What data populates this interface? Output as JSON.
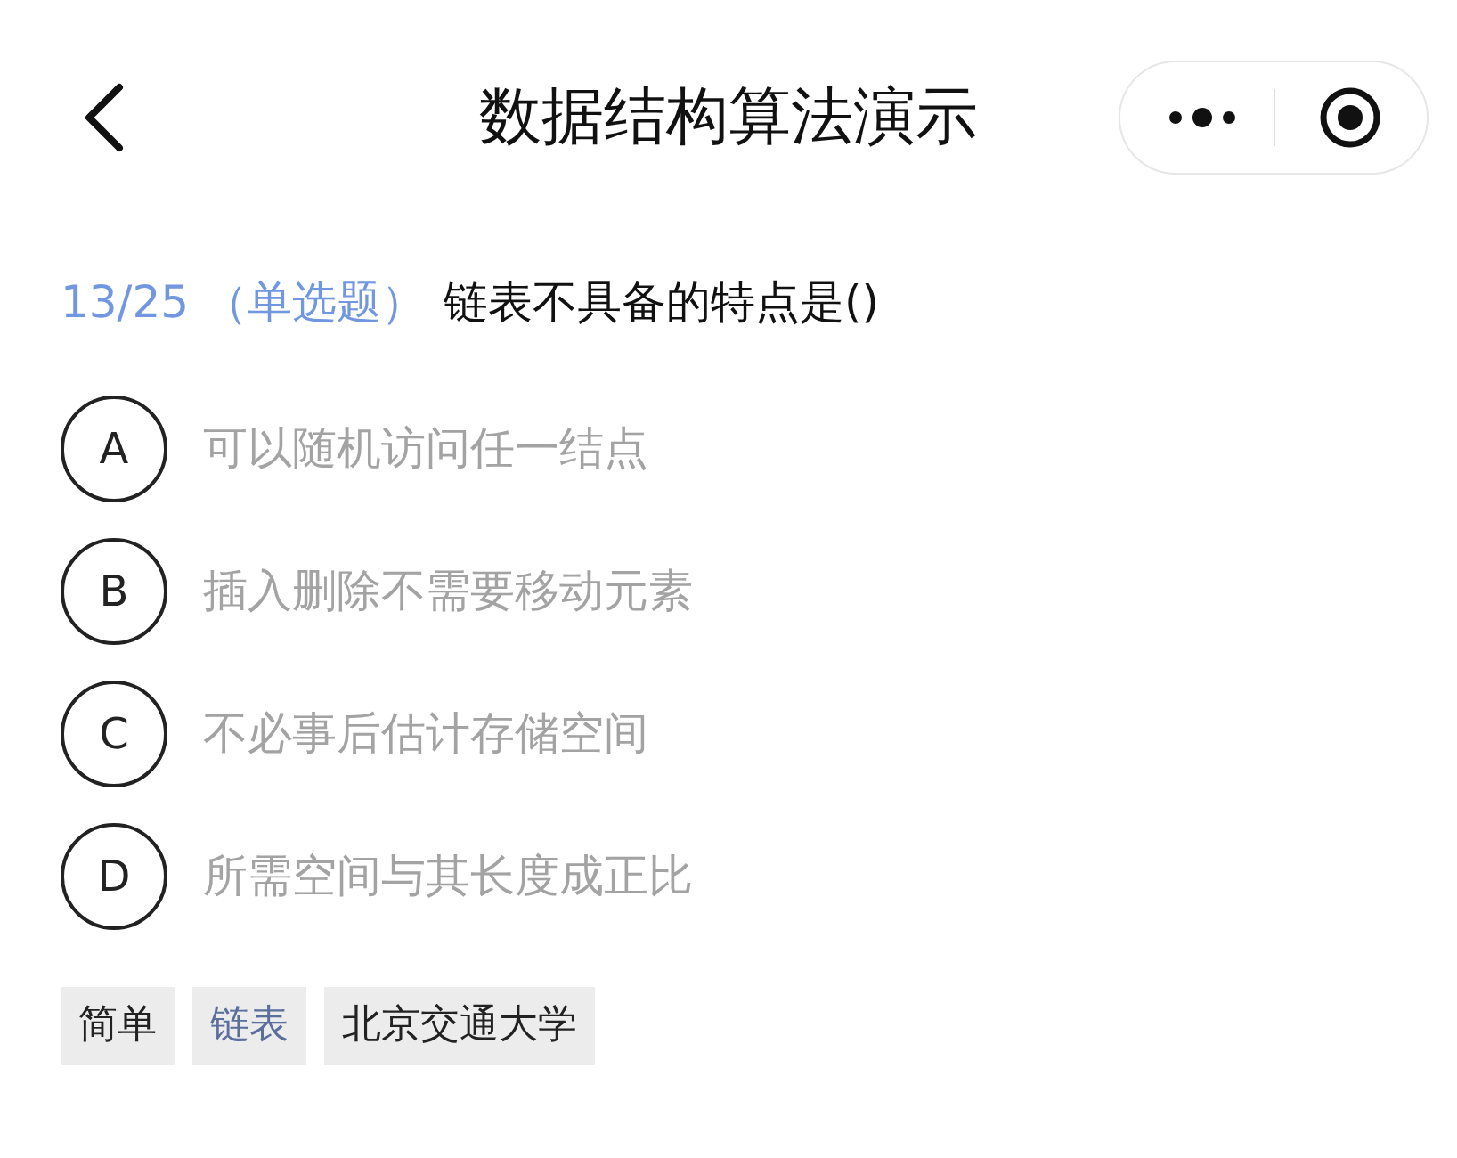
{
  "header": {
    "title": "数据结构算法演示"
  },
  "question": {
    "number": "13/25",
    "type": "（单选题）",
    "text": "链表不具备的特点是()"
  },
  "options": [
    {
      "letter": "A",
      "text": "可以随机访问任一结点",
      "selected": false
    },
    {
      "letter": "B",
      "text": "插入删除不需要移动元素",
      "selected": false
    },
    {
      "letter": "C",
      "text": "不必事后估计存储空间",
      "selected": false
    },
    {
      "letter": "D",
      "text": "所需空间与其长度成正比",
      "selected": false
    }
  ],
  "tags": [
    {
      "label": "简单",
      "color": "#222222"
    },
    {
      "label": "链表",
      "color": "#5b6f9c"
    },
    {
      "label": "北京交通大学",
      "color": "#222222"
    }
  ]
}
